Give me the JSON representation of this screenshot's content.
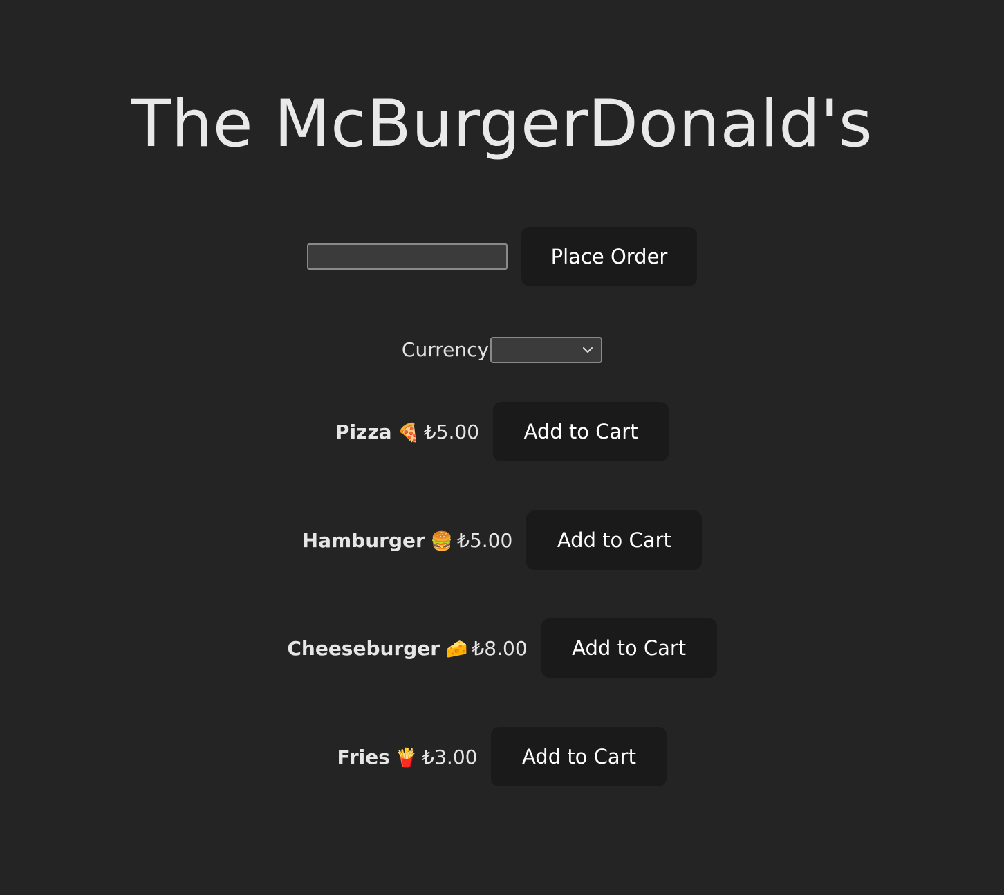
{
  "header": {
    "title": "The McBurgerDonald's"
  },
  "order": {
    "input_value": "",
    "place_order_label": "Place Order"
  },
  "currency": {
    "label": "Currency",
    "selected": ""
  },
  "menu": {
    "items": [
      {
        "name": "Pizza",
        "emoji": "🍕",
        "price": "₺5.00",
        "button_label": "Add to Cart"
      },
      {
        "name": "Hamburger",
        "emoji": "🍔",
        "price": "₺5.00",
        "button_label": "Add to Cart"
      },
      {
        "name": "Cheeseburger",
        "emoji": "🧀",
        "price": "₺8.00",
        "button_label": "Add to Cart"
      },
      {
        "name": "Fries",
        "emoji": "🍟",
        "price": "₺3.00",
        "button_label": "Add to Cart"
      }
    ]
  },
  "icons": {
    "select_chevron": "chevron-down-icon"
  },
  "colors": {
    "background": "#242424",
    "button_background": "#1a1a1a",
    "text": "#e9e9e9",
    "input_background": "#3b3b3b",
    "input_border": "#8a8a8a"
  }
}
